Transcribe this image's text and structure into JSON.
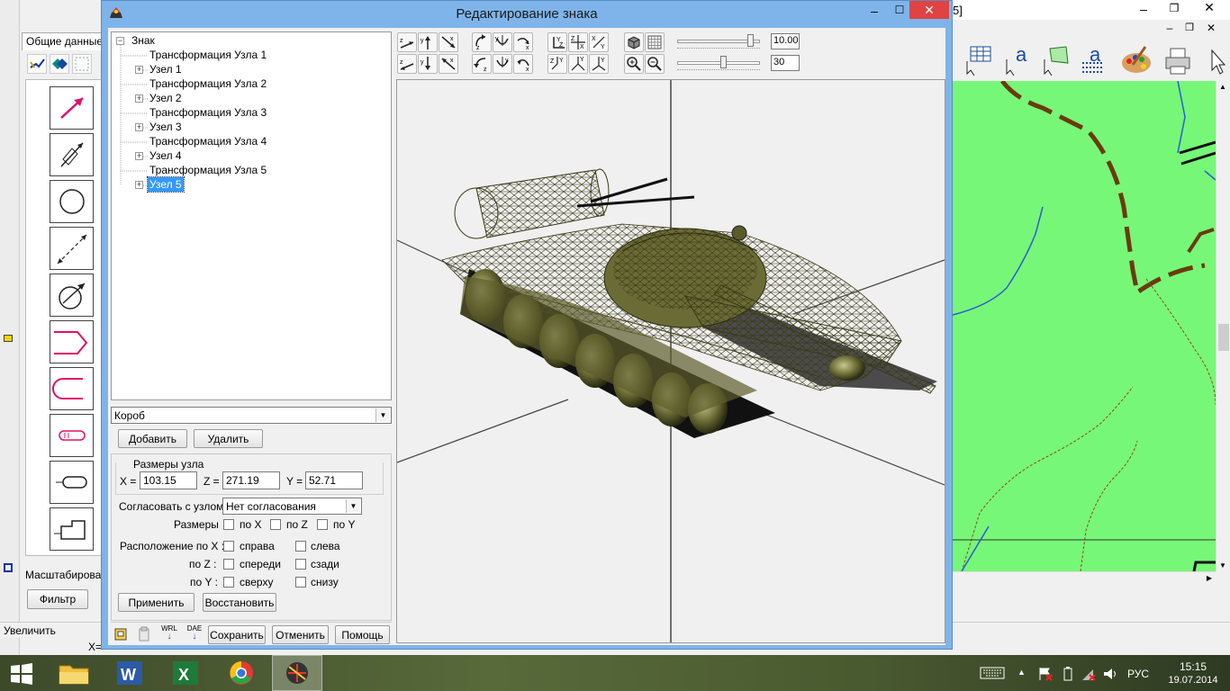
{
  "dialog": {
    "title": "Редактирование знака",
    "tree": {
      "root": "Знак",
      "items": [
        {
          "label": "Трансформация Узла 1",
          "expandable": false
        },
        {
          "label": "Узел 1",
          "expandable": true
        },
        {
          "label": "Трансформация Узла 2",
          "expandable": false
        },
        {
          "label": "Узел 2",
          "expandable": true
        },
        {
          "label": "Трансформация Узла 3",
          "expandable": false
        },
        {
          "label": "Узел 3",
          "expandable": true
        },
        {
          "label": "Трансформация Узла 4",
          "expandable": false
        },
        {
          "label": "Узел 4",
          "expandable": true
        },
        {
          "label": "Трансформация Узла 5",
          "expandable": false
        },
        {
          "label": "Узел 5",
          "expandable": true,
          "selected": true
        }
      ]
    },
    "shape_select": "Короб",
    "add_button": "Добавить",
    "delete_button": "Удалить",
    "size_group": {
      "title": "Размеры узла",
      "x_label": "X =",
      "x_value": "103.15",
      "z_label": "Z =",
      "z_value": "271.19",
      "y_label": "Y =",
      "y_value": "52.71"
    },
    "align_label": "Согласовать с узлом",
    "align_select": "Нет согласования",
    "sizes_label": "Размеры",
    "sizes_checks": [
      "по X",
      "по Z",
      "по Y"
    ],
    "position_label": "Расположение по X :",
    "pos_x": [
      "справа",
      "слева"
    ],
    "pos_z_label": "по Z :",
    "pos_z": [
      "спереди",
      "сзади"
    ],
    "pos_y_label": "по Y :",
    "pos_y": [
      "сверху",
      "снизу"
    ],
    "apply_button": "Применить",
    "restore_button": "Восстановить",
    "bottom": {
      "wrl_label": "WRL",
      "dae_label": "DAE",
      "save_button": "Сохранить",
      "cancel_button": "Отменить",
      "help_button": "Помощь"
    },
    "toolbar": {
      "value1": "10.00",
      "value2": "30",
      "slider1": 0.9,
      "slider2": 0.55
    }
  },
  "main_app": {
    "tab_label": "Общие данные",
    "scale_label": "Масштабирован",
    "filter_button": "Фильтр",
    "status_text": "Увеличить",
    "coord_prefix": "X=",
    "title_fragment": "5]"
  },
  "taskbar": {
    "lang": "РУС",
    "time": "15:15",
    "date": "19.07.2014"
  },
  "colors": {
    "map_green": "#77f777",
    "road_brown": "#6b3a10",
    "river_blue": "#2a5cd8",
    "close_red": "#e04343",
    "tank_olive": "#6b6b35"
  }
}
